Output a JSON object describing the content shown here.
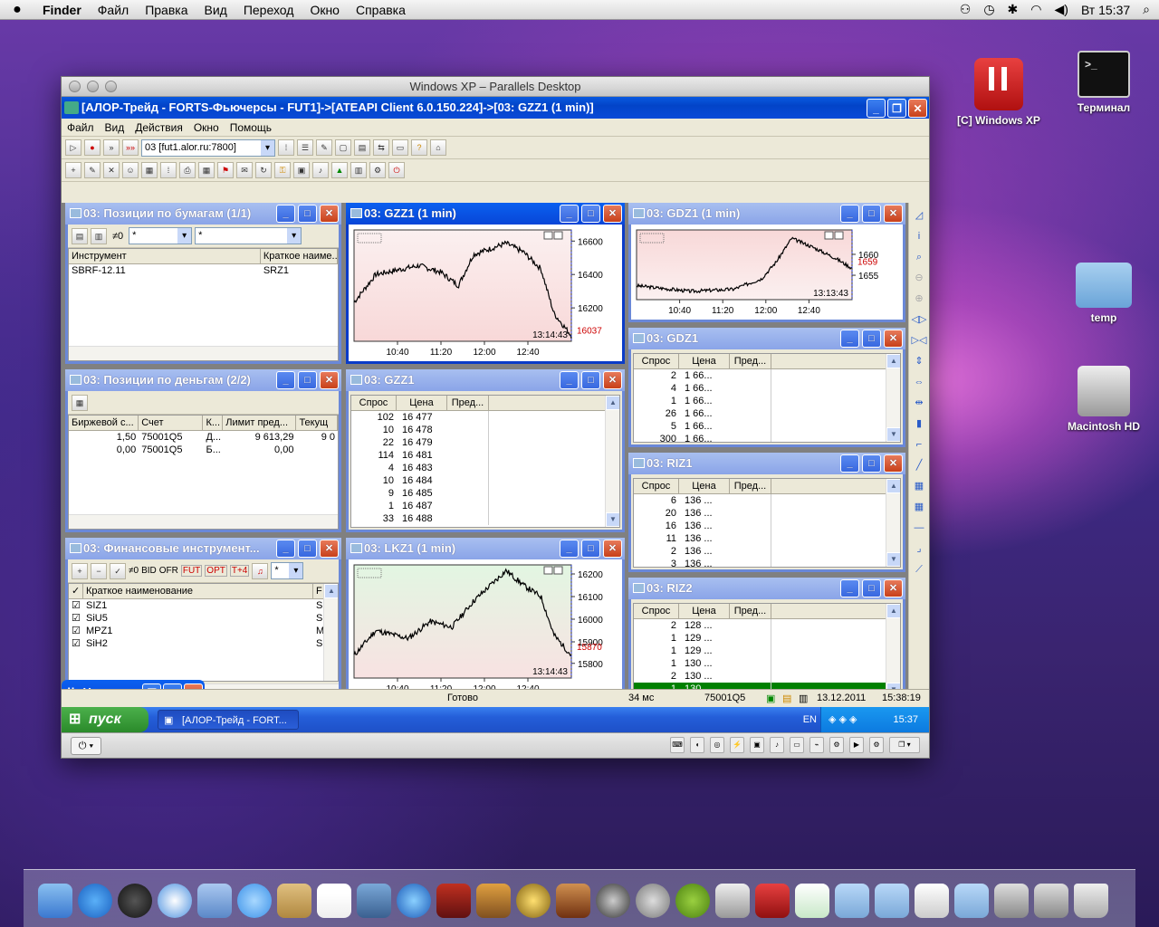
{
  "menubar": {
    "apple": "",
    "items": [
      "Finder",
      "Файл",
      "Правка",
      "Вид",
      "Переход",
      "Окно",
      "Справка"
    ],
    "clock": "Вт 15:37"
  },
  "desktop": {
    "icons": [
      {
        "label": "[C] Windows XP"
      },
      {
        "label": "Терминал"
      },
      {
        "label": "temp"
      },
      {
        "label": "Macintosh HD"
      }
    ]
  },
  "parallels": {
    "title": "Windows XP – Parallels Desktop"
  },
  "app": {
    "title": "[АЛОР-Трейд - FORTS-Фьючерсы - FUT1]->[ATEAPI Client 6.0.150.224]->[03: GZZ1 (1 min)]",
    "menu": [
      "Файл",
      "Вид",
      "Действия",
      "Окно",
      "Помощь"
    ],
    "server_combo": "03 [fut1.alor.ru:7800]"
  },
  "win_pos_papers": {
    "title": "03: Позиции по бумагам (1/1)",
    "filter_label": "≠0",
    "filter1": "*",
    "filter2": "*",
    "columns": [
      "Инструмент",
      "Краткое наиме..."
    ],
    "rows": [
      [
        "SBRF-12.11",
        "SRZ1"
      ]
    ]
  },
  "win_pos_money": {
    "title": "03: Позиции по деньгам (2/2)",
    "columns": [
      "Биржевой с...",
      "Счет",
      "К...",
      "Лимит пред...",
      "Текущ"
    ],
    "rows": [
      [
        "1,50",
        "75001Q5",
        "Д...",
        "9 613,29",
        "9 0"
      ],
      [
        "0,00",
        "75001Q5",
        "Б...",
        "0,00",
        ""
      ]
    ]
  },
  "win_instruments": {
    "title": "03: Финансовые инструмент...",
    "toolbar": [
      "≠0",
      "BID",
      "OFR",
      "FUT",
      "OPT",
      "T+4"
    ],
    "filter": "*",
    "columns": [
      "Краткое наименование",
      "F"
    ],
    "rows": [
      [
        "SIZ1",
        "S"
      ],
      [
        "SiU5",
        "S"
      ],
      [
        "MPZ1",
        "M"
      ],
      [
        "SiH2",
        "S"
      ]
    ]
  },
  "chart_gzz1": {
    "title": "03: GZZ1 (1 min)",
    "time_label": "13:14:43",
    "last": "16037",
    "yticks": [
      "16600",
      "16400",
      "16200"
    ],
    "xticks": [
      "10:40",
      "11:20",
      "12:00",
      "12:40"
    ]
  },
  "chart_gdz1": {
    "title": "03: GDZ1 (1 min)",
    "time_label": "13:13:43",
    "last": "1659",
    "yticks": [
      "1660",
      "1655"
    ],
    "xticks": [
      "10:40",
      "11:20",
      "12:00",
      "12:40"
    ]
  },
  "chart_lkz1": {
    "title": "03: LKZ1 (1 min)",
    "time_label": "13:14:43",
    "last": "15870",
    "yticks": [
      "16200",
      "16100",
      "16000",
      "15900",
      "15800"
    ],
    "xticks": [
      "10:40",
      "11:20",
      "12:00",
      "12:40"
    ]
  },
  "book_gzz1": {
    "title": "03: GZZ1",
    "columns": [
      "Спрос",
      "Цена",
      "Пред..."
    ],
    "rows": [
      [
        "102",
        "16 477"
      ],
      [
        "10",
        "16 478"
      ],
      [
        "22",
        "16 479"
      ],
      [
        "114",
        "16 481"
      ],
      [
        "4",
        "16 483"
      ],
      [
        "10",
        "16 484"
      ],
      [
        "9",
        "16 485"
      ],
      [
        "1",
        "16 487"
      ],
      [
        "33",
        "16 488"
      ]
    ]
  },
  "book_gdz1": {
    "title": "03: GDZ1",
    "columns": [
      "Спрос",
      "Цена",
      "Пред..."
    ],
    "rows": [
      [
        "2",
        "1 66..."
      ],
      [
        "4",
        "1 66..."
      ],
      [
        "1",
        "1 66..."
      ],
      [
        "26",
        "1 66..."
      ],
      [
        "5",
        "1 66..."
      ],
      [
        "300",
        "1 66..."
      ]
    ]
  },
  "book_riz1": {
    "title": "03: RIZ1",
    "columns": [
      "Спрос",
      "Цена",
      "Пред..."
    ],
    "rows": [
      [
        "6",
        "136 ..."
      ],
      [
        "20",
        "136 ..."
      ],
      [
        "16",
        "136 ..."
      ],
      [
        "11",
        "136 ..."
      ],
      [
        "2",
        "136 ..."
      ],
      [
        "3",
        "136 ..."
      ]
    ]
  },
  "book_riz2": {
    "title": "03: RIZ2",
    "columns": [
      "Спрос",
      "Цена",
      "Пред..."
    ],
    "rows": [
      [
        "2",
        "128 ..."
      ],
      [
        "1",
        "129 ..."
      ],
      [
        "1",
        "129 ..."
      ],
      [
        "1",
        "130 ..."
      ],
      [
        "2",
        "130 ..."
      ],
      [
        "1",
        "130 ..."
      ]
    ]
  },
  "minimized": {
    "title": "Управ..."
  },
  "status": {
    "ready": "Готово",
    "latency": "34 мс",
    "account": "75001Q5",
    "date": "13.12.2011",
    "time": "15:38:19"
  },
  "taskbar": {
    "start": "пуск",
    "task": "[АЛОР-Трейд - FORT...",
    "lang": "EN",
    "clock": "15:37"
  },
  "colors": {
    "xp_blue": "#0a5ae0",
    "chart_red_bg": "#fbe4e4",
    "chart_green_bg": "#e6f6e6",
    "highlight_green": "#008000"
  }
}
